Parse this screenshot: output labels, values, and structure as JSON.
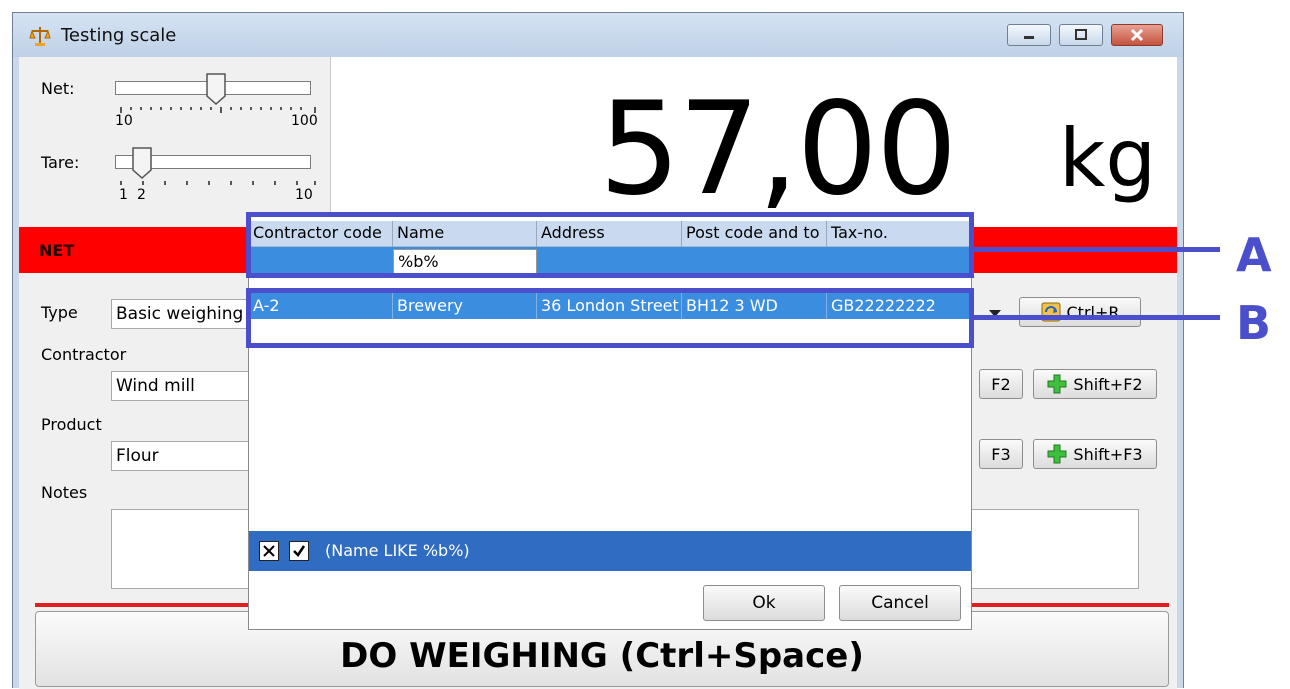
{
  "window": {
    "title": "Testing scale",
    "icon": "scale-icon"
  },
  "sliders": {
    "net": {
      "label": "Net:",
      "min_label": "10",
      "max_label": "100",
      "value_fraction": 0.45
    },
    "tare": {
      "label": "Tare:",
      "min_label": "1",
      "second_label": "2",
      "max_label": "10",
      "value_fraction": 0.12
    }
  },
  "display": {
    "weight": "57,00",
    "unit": "kg",
    "mode": "NET"
  },
  "form": {
    "type_label": "Type",
    "type_value": "Basic weighing",
    "type_shortcut": "Ctrl+R",
    "contractor_label": "Contractor",
    "contractor_value": "Wind mill",
    "contractor_shortcut": "F2",
    "contractor_add": "Shift+F2",
    "product_label": "Product",
    "product_value": "Flour",
    "product_shortcut": "F3",
    "product_add": "Shift+F3",
    "notes_label": "Notes",
    "weigh_button": "DO WEIGHING (Ctrl+Space)"
  },
  "dialog": {
    "columns": [
      "Contractor code",
      "Name",
      "Address",
      "Post code and to",
      "Tax-no."
    ],
    "filter_value": "%b%",
    "rows": [
      [
        "A-2",
        "Brewery",
        "36 London Street",
        "BH12 3 WD",
        "GB22222222"
      ]
    ],
    "filter_text": "(Name LIKE %b%)",
    "ok_label": "Ok",
    "cancel_label": "Cancel"
  },
  "callouts": {
    "a": "A",
    "b": "B"
  },
  "colors": {
    "accent_blue": "#3b8de0",
    "net_red": "#ff0000",
    "callout": "#4b4fcb"
  }
}
